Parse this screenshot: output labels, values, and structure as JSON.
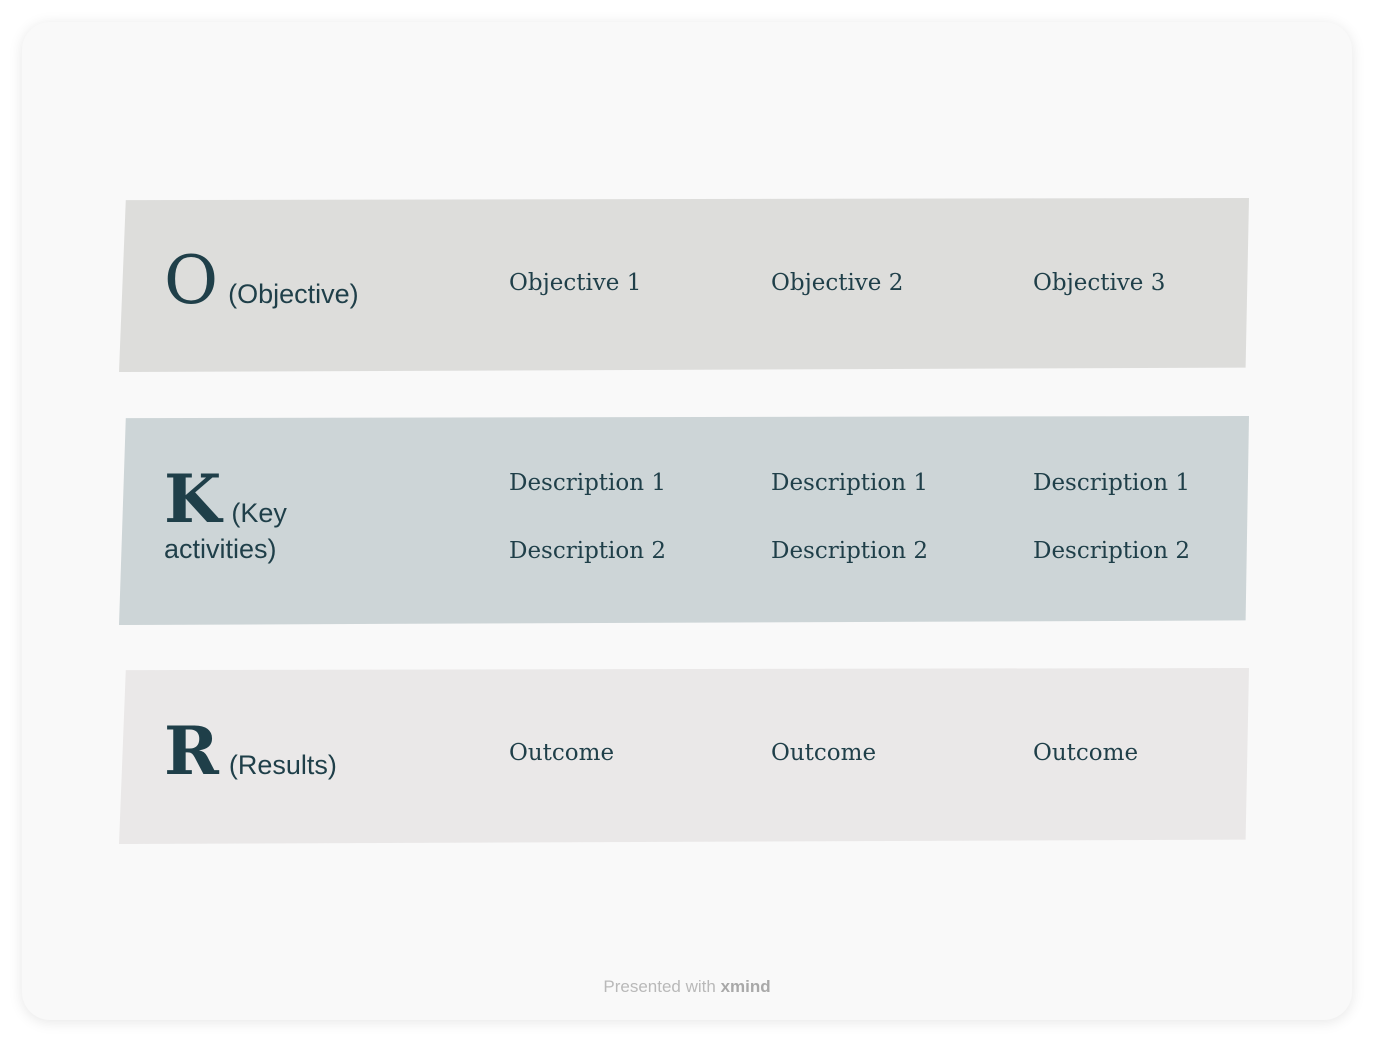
{
  "objective": {
    "letter": "O",
    "label": "(Objective)",
    "items": [
      "Objective 1",
      "Objective 2",
      "Objective 3"
    ]
  },
  "key_activities": {
    "letter": "K",
    "label_line1": "(Key",
    "label_line2": "activities)",
    "columns": [
      [
        "Description 1",
        "Description 2"
      ],
      [
        "Description 1",
        "Description 2"
      ],
      [
        "Description 1",
        "Description 2"
      ]
    ]
  },
  "results": {
    "letter": "R",
    "label": "(Results)",
    "items": [
      "Outcome",
      "Outcome",
      "Outcome"
    ]
  },
  "footer": {
    "prefix": "Presented with",
    "brand": "xmind"
  },
  "colors": {
    "text": "#1f3f49",
    "objective_band": "#dddddb",
    "key_band": "#cdd5d7",
    "results_band": "#eae8e8"
  }
}
